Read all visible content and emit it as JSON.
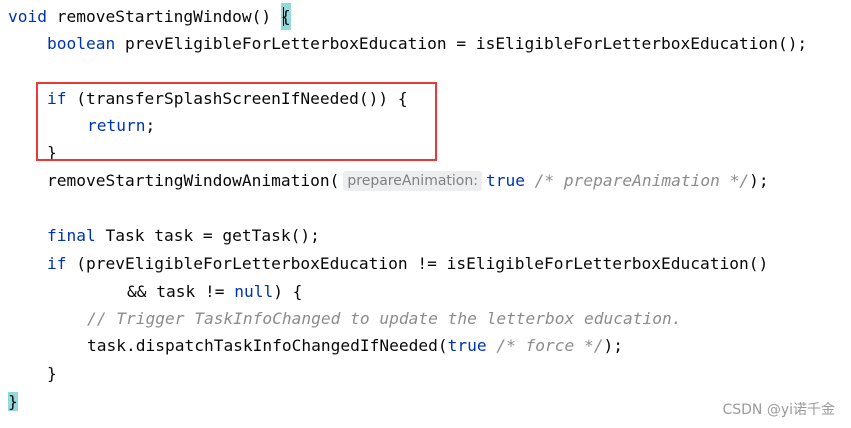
{
  "code": {
    "line1": {
      "kw_void": "void",
      "name": " removeStartingWindow() ",
      "brace": "{"
    },
    "line2": {
      "kw_boolean": "boolean",
      "rest": " prevEligibleForLetterboxEducation = isEligibleForLetterboxEducation();"
    },
    "line4": {
      "kw_if": "if",
      "rest": " (transferSplashScreenIfNeeded()) {"
    },
    "line5": {
      "kw_return": "return",
      "rest": ";"
    },
    "line6": {
      "brace": "}"
    },
    "line7": {
      "call": "removeStartingWindowAnimation(",
      "hint": "prepareAnimation:",
      "kw_true": "true",
      "comment": " /* prepareAnimation */",
      "end": ");"
    },
    "line9": {
      "kw_final": "final",
      "rest": " Task task = getTask();"
    },
    "line10": {
      "kw_if": "if",
      "rest": " (prevEligibleForLetterboxEducation != isEligibleForLetterboxEducation()"
    },
    "line11": {
      "pre": "&& task != ",
      "kw_null": "null",
      "post": ") {"
    },
    "line12": {
      "comment": "// Trigger TaskInfoChanged to update the letterbox education."
    },
    "line13": {
      "pre": "task.dispatchTaskInfoChangedIfNeeded(",
      "kw_true": "true",
      "comment": " /* force */",
      "end": ");"
    },
    "line14": {
      "brace": "}"
    },
    "line15": {
      "brace": "}"
    }
  },
  "watermark": "CSDN @yi诺千金",
  "colors": {
    "keyword": "#0033b3",
    "comment": "#8c8c8c",
    "text": "#080808",
    "brace_match_bg": "#93d9d9",
    "highlight_box": "#e63a3a",
    "hint_bg": "#edeef0"
  }
}
